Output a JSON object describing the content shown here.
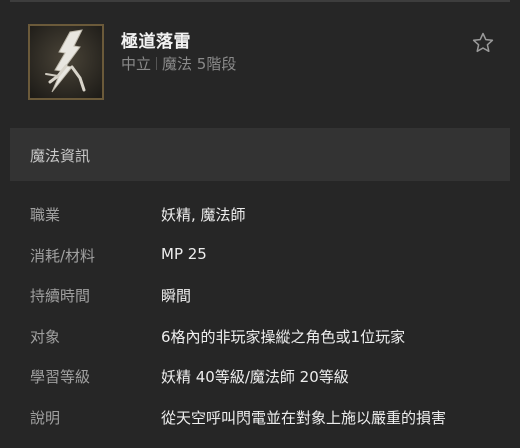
{
  "skill": {
    "name": "極道落雷",
    "alignment": "中立",
    "category": "魔法 5階段",
    "icon": "lightning-bolt-icon",
    "favorite_icon": "star-outline-icon"
  },
  "section": {
    "title": "魔法資訊"
  },
  "info_rows": [
    {
      "label": "職業",
      "value": "妖精, 魔法師"
    },
    {
      "label": "消耗/材料",
      "value": "MP 25"
    },
    {
      "label": "持續時間",
      "value": "瞬間"
    },
    {
      "label": "对象",
      "value": "6格內的非玩家操縱之角色或1位玩家"
    },
    {
      "label": "學習等級",
      "value": "妖精 40等級/魔法師 20等級"
    },
    {
      "label": "說明",
      "value": "從天空呼叫閃電並在對象上施以嚴重的損害"
    }
  ],
  "colors": {
    "background": "#262626",
    "section_background": "#333333",
    "icon_border": "#6b5a3a",
    "label_text": "#a0a0a0",
    "value_text": "#ededed"
  }
}
